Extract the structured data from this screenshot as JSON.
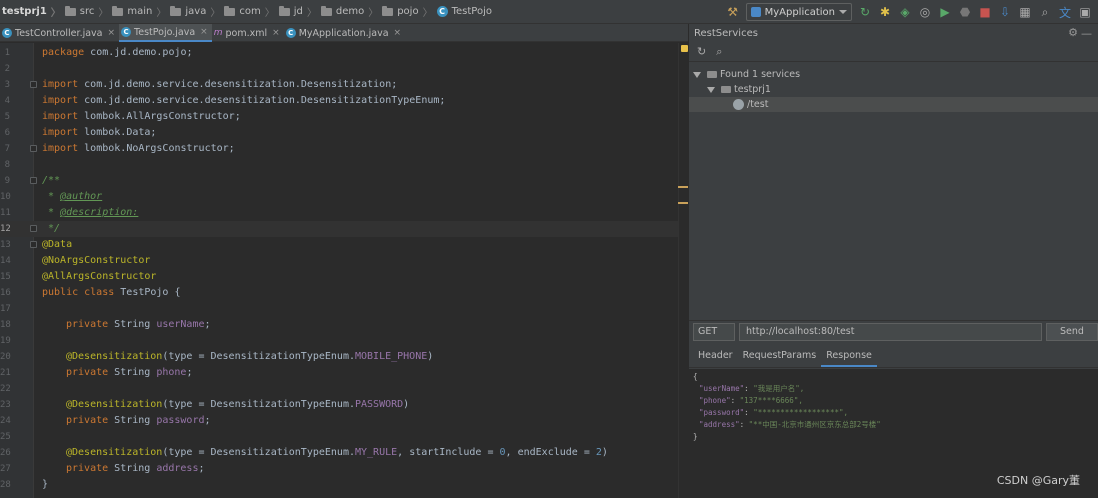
{
  "breadcrumb": [
    "testprj1",
    "src",
    "main",
    "java",
    "com",
    "jd",
    "demo",
    "pojo",
    "TestPojo"
  ],
  "toolbar": {
    "run_config": "MyApplication"
  },
  "tabs": [
    {
      "label": "TestController.java",
      "icon": "class-icon"
    },
    {
      "label": "TestPojo.java",
      "icon": "class-icon",
      "active": true
    },
    {
      "label": "pom.xml",
      "icon": "maven-icon"
    },
    {
      "label": "MyApplication.java",
      "icon": "class-icon"
    }
  ],
  "editor": {
    "line_numbers": [
      "1",
      "2",
      "3",
      "4",
      "5",
      "6",
      "7",
      "8",
      "9",
      "10",
      "11",
      "12",
      "13",
      "14",
      "15",
      "16",
      "17",
      "18",
      "19",
      "20",
      "21",
      "22",
      "23",
      "24",
      "25",
      "26",
      "27",
      "28"
    ],
    "lines": {
      "l1": {
        "kw": "package ",
        "rest": "com.jd.demo.pojo;"
      },
      "l3": {
        "kw": "import ",
        "pkg": "com.jd.demo.service.desensitization.",
        "cls": "Desensitization",
        "end": ";"
      },
      "l4": {
        "kw": "import ",
        "pkg": "com.jd.demo.service.desensitization.",
        "cls": "DesensitizationTypeEnum",
        "end": ";"
      },
      "l5": {
        "kw": "import ",
        "pkg": "lombok.",
        "cls": "AllArgsConstructor",
        "end": ";"
      },
      "l6": {
        "kw": "import ",
        "pkg": "lombok.",
        "cls": "Data",
        "end": ";"
      },
      "l7": {
        "kw": "import ",
        "pkg": "lombok.",
        "cls": "NoArgsConstructor",
        "end": ";"
      },
      "l9": {
        "cmt": "/**"
      },
      "l10": {
        "cmt": " * ",
        "tag": "@author"
      },
      "l11": {
        "cmt": " * ",
        "tag": "@description:"
      },
      "l12": {
        "cmt": " */"
      },
      "l13": {
        "ann": "@Data"
      },
      "l14": {
        "ann": "@NoArgsConstructor"
      },
      "l15": {
        "ann": "@AllArgsConstructor"
      },
      "l16": {
        "kw": "public class ",
        "cls": "TestPojo",
        "end": " {"
      },
      "l18": {
        "kw": "private ",
        "type": "String ",
        "fld": "userName",
        "end": ";"
      },
      "l20": {
        "ann": "@Desensitization",
        "a": "(type = ",
        "b": "DesensitizationTypeEnum.",
        "fld": "MOBILE_PHONE",
        "end": ")"
      },
      "l21": {
        "kw": "private ",
        "type": "String ",
        "fld": "phone",
        "end": ";"
      },
      "l23": {
        "ann": "@Desensitization",
        "a": "(type = ",
        "b": "DesensitizationTypeEnum.",
        "fld": "PASSWORD",
        "end": ")"
      },
      "l24": {
        "kw": "private ",
        "type": "String ",
        "fld": "password",
        "end": ";"
      },
      "l26": {
        "ann": "@Desensitization",
        "a": "(type = ",
        "b": "DesensitizationTypeEnum.",
        "fld": "MY_RULE",
        "c": ", startInclude = ",
        "n1": "0",
        "d": ", endExclude = ",
        "n2": "2",
        "end": ")"
      },
      "l27": {
        "kw": "private ",
        "type": "String ",
        "fld": "address",
        "end": ";"
      },
      "l28": {
        "end": "}"
      }
    }
  },
  "rest_panel": {
    "title": "RestServices",
    "tree": {
      "root": "Found 1 services",
      "module": "testprj1",
      "endpoint": "/test"
    },
    "request": {
      "method": "GET",
      "url": "http://localhost:80/test",
      "send_label": "Send"
    },
    "tabs": [
      "Header",
      "RequestParams",
      "Response"
    ],
    "active_tab": "Response",
    "response": {
      "open": "{",
      "rows": [
        {
          "key": "\"userName\"",
          "sep": ": ",
          "val": "\"我是用户名\","
        },
        {
          "key": "\"phone\"",
          "sep": ": ",
          "val": "\"137****6666\","
        },
        {
          "key": "\"password\"",
          "sep": ": ",
          "val": "\"******************\","
        },
        {
          "key": "\"address\"",
          "sep": ": ",
          "val": "\"**中国-北京市通州区京东总部2号楼\""
        }
      ],
      "close": "}"
    }
  },
  "watermark": "CSDN @Gary董"
}
